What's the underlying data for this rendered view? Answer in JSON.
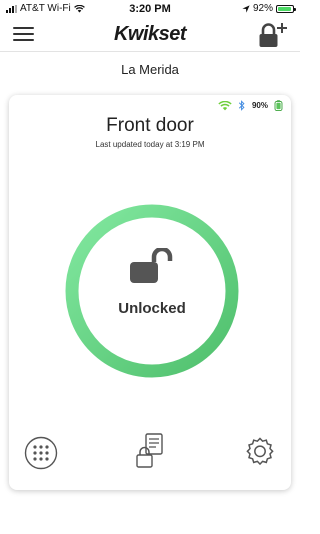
{
  "status_bar": {
    "carrier": "AT&T Wi-Fi",
    "time": "3:20 PM",
    "battery_percent": "92%"
  },
  "header": {
    "logo_text": "Kwikset",
    "menu_icon": "hamburger-menu-icon",
    "add_lock_icon": "add-lock-icon"
  },
  "location": {
    "name": "La Merida"
  },
  "lock": {
    "name": "Front door",
    "last_updated": "Last updated today at 3:19 PM",
    "status": "Unlocked",
    "battery": "90%",
    "status_color": "#5fcf82",
    "wifi_connected": true,
    "bluetooth_connected": true
  },
  "actions": {
    "keypad_icon": "keypad-icon",
    "history_icon": "history-icon",
    "settings_icon": "gear-icon"
  },
  "colors": {
    "accent_green": "#6fdc8c",
    "bluetooth_blue": "#4a90e2"
  }
}
